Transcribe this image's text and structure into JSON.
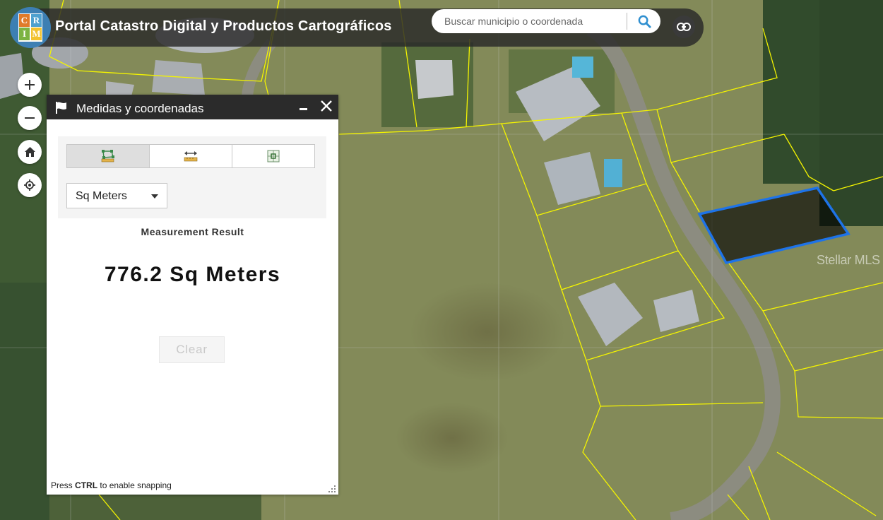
{
  "header": {
    "title": "Portal Catastro Digital y Productos Cartográficos",
    "logo_letters": [
      "C",
      "R",
      "I",
      "M"
    ],
    "search_placeholder": "Buscar municipio o coordenada"
  },
  "map_controls": {
    "icons": [
      "plus-icon",
      "minus-icon",
      "home-icon",
      "locate-icon"
    ]
  },
  "panel": {
    "title": "Medidas y coordenadas",
    "tools": [
      {
        "name": "area-tool",
        "active": true
      },
      {
        "name": "distance-tool",
        "active": false
      },
      {
        "name": "location-tool",
        "active": false
      }
    ],
    "unit": "Sq Meters",
    "result_label": "Measurement Result",
    "result_value": "776.2 Sq Meters",
    "clear_label": "Clear",
    "hint_prefix": "Press",
    "hint_key": "CTRL",
    "hint_suffix": "to enable snapping"
  },
  "map": {
    "watermark": "Stellar MLS",
    "parcel_line_color": "#f4f400",
    "measure_color": "#1e73e8"
  }
}
